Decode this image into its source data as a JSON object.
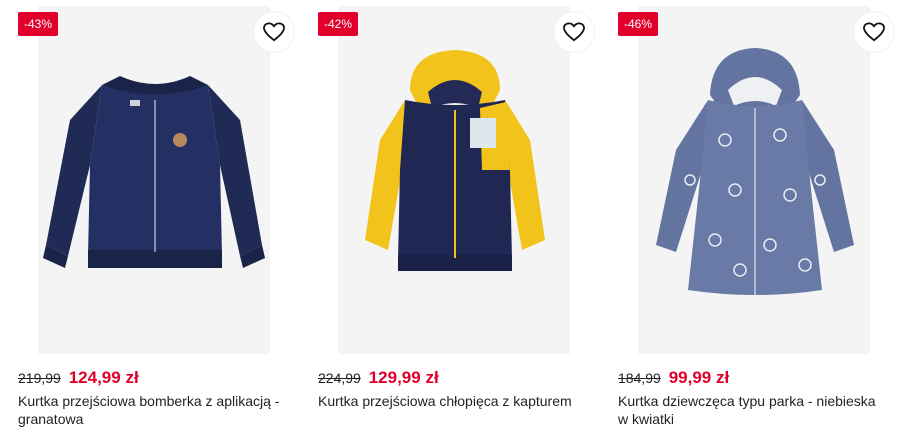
{
  "colors": {
    "badge": "#e0002a",
    "price_new": "#e0002a"
  },
  "icons": {
    "favorite": "heart-outline-icon"
  },
  "products": [
    {
      "discount": "-43%",
      "old_price": "219,99",
      "new_price": "124,99 zł",
      "title": "Kurtka przejściowa bomberka z aplikacją - granatowa"
    },
    {
      "discount": "-42%",
      "old_price": "224,99",
      "new_price": "129,99 zł",
      "title": "Kurtka przejściowa chłopięca z kapturem"
    },
    {
      "discount": "-46%",
      "old_price": "184,99",
      "new_price": "99,99 zł",
      "title": "Kurtka dziewczęca typu parka - niebieska w kwiatki"
    }
  ]
}
